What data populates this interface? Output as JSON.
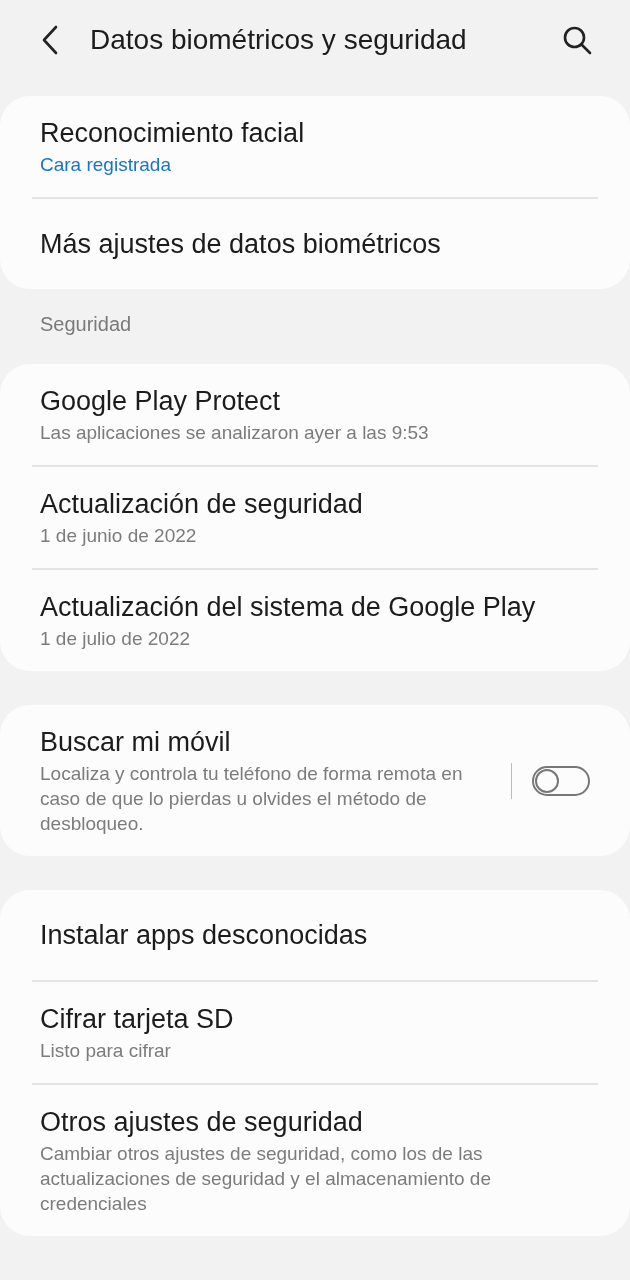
{
  "header": {
    "title": "Datos biométricos y seguridad"
  },
  "groups": [
    {
      "items": [
        {
          "kind": "link",
          "title": "Reconocimiento facial",
          "subtitle": "Cara registrada",
          "accent": true
        },
        {
          "kind": "link",
          "title": "Más ajustes de datos biométricos"
        }
      ]
    },
    {
      "heading": "Seguridad",
      "items": [
        {
          "kind": "link",
          "title": "Google Play Protect",
          "subtitle": "Las aplicaciones se analizaron ayer a las 9:53",
          "accent": false
        },
        {
          "kind": "link",
          "title": "Actualización de seguridad",
          "subtitle": "1 de junio de 2022",
          "accent": false
        },
        {
          "kind": "link",
          "title": "Actualización del sistema de Google Play",
          "subtitle": "1 de julio de 2022",
          "accent": false
        }
      ]
    },
    {
      "items": [
        {
          "kind": "toggle",
          "title": "Buscar mi móvil",
          "subtitle": "Localiza y controla tu teléfono de forma remota en caso de que lo pierdas u olvides el método de desbloqueo.",
          "accent": false,
          "on": false
        }
      ]
    },
    {
      "items": [
        {
          "kind": "link",
          "title": "Instalar apps desconocidas"
        },
        {
          "kind": "link",
          "title": "Cifrar tarjeta SD",
          "subtitle": "Listo para cifrar",
          "accent": false
        },
        {
          "kind": "link",
          "title": "Otros ajustes de seguridad",
          "subtitle": "Cambiar otros ajustes de seguridad, como los de las actualizaciones de seguridad y el almacenamiento de credenciales",
          "accent": false
        }
      ]
    }
  ]
}
